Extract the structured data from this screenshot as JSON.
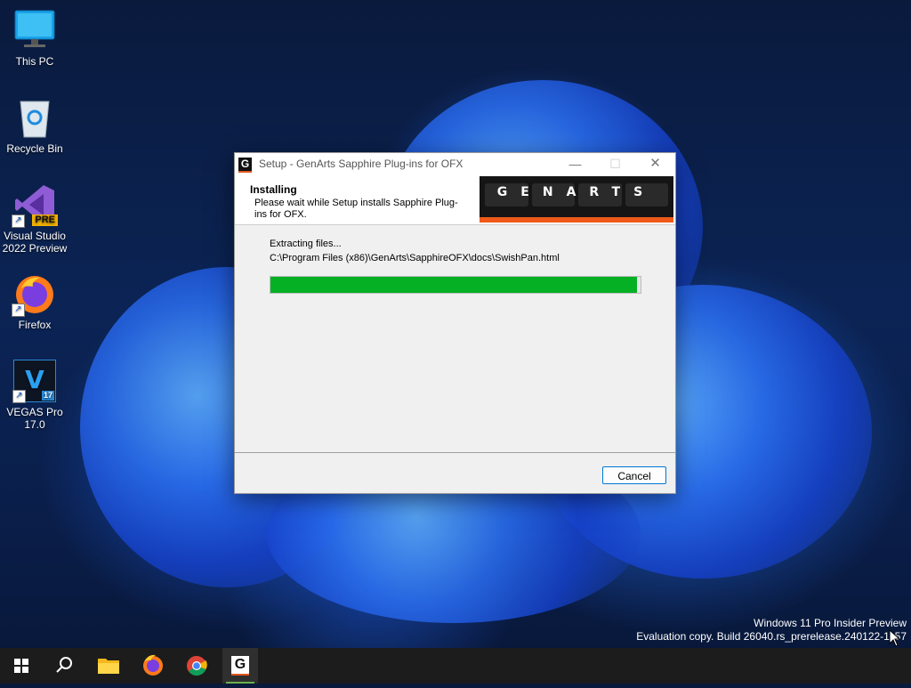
{
  "desktop": {
    "icons": [
      {
        "label": "This PC"
      },
      {
        "label": "Recycle Bin"
      },
      {
        "label": "Visual Studio 2022 Preview",
        "badge": "PRE"
      },
      {
        "label": "Firefox"
      },
      {
        "label": "VEGAS Pro 17.0",
        "glyph": "V",
        "badge": "17"
      }
    ]
  },
  "dialog": {
    "title": "Setup - GenArts Sapphire Plug-ins for OFX",
    "app_glyph": "G",
    "header_title": "Installing",
    "header_subtitle": "Please wait while Setup installs Sapphire Plug-ins for OFX.",
    "logo_text": "GENARTS",
    "status": "Extracting files...",
    "current_file": "C:\\Program Files (x86)\\GenArts\\SapphireOFX\\docs\\SwishPan.html",
    "progress_percent": 99,
    "cancel_label": "Cancel",
    "minimize_glyph": "—",
    "maximize_glyph": "☐",
    "close_glyph": "✕"
  },
  "watermark": {
    "line1": "Windows 11 Pro Insider Preview",
    "line2": "Evaluation copy. Build 26040.rs_prerelease.240122-1157"
  },
  "taskbar": {
    "items": [
      "start",
      "search",
      "file-explorer",
      "firefox",
      "chrome",
      "genarts-setup"
    ],
    "active": "genarts-setup",
    "active_glyph": "G"
  },
  "colors": {
    "progress": "#06b025",
    "logo_stripe": "#ef5a1a",
    "focus": "#0078d4"
  }
}
